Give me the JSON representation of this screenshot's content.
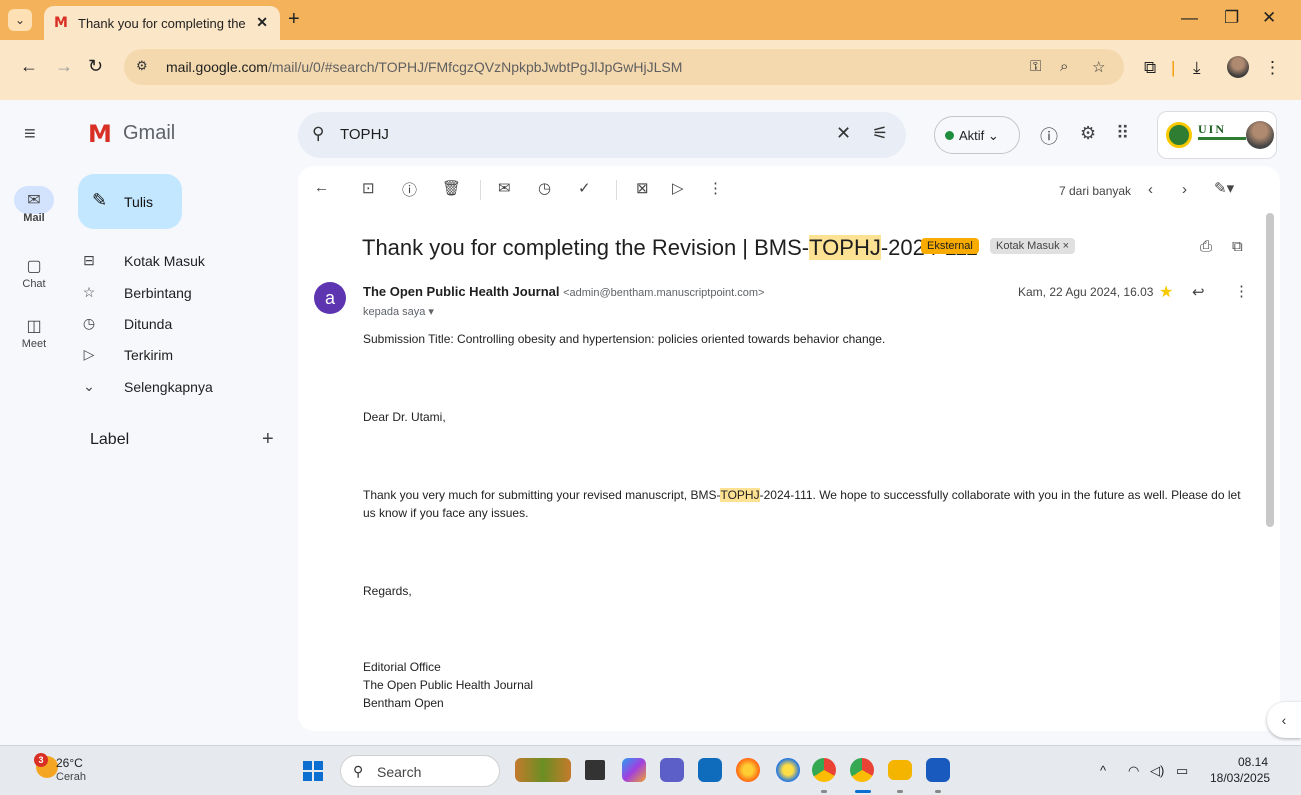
{
  "browser": {
    "tab_title": "Thank you for completing the R",
    "tab_close": "✕",
    "new_tab": "+",
    "url_domain": "mail.google.com",
    "url_path": "/mail/u/0/#search/TOPHJ/FMfcgzQVzNpkpbJwbtPgJlJpGwHjJLSM"
  },
  "gmail": {
    "app_name": "Gmail",
    "compose_label": "Tulis",
    "rail": [
      {
        "label": "Mail",
        "icon": "mail-icon"
      },
      {
        "label": "Chat",
        "icon": "chat-icon"
      },
      {
        "label": "Meet",
        "icon": "meet-icon"
      }
    ],
    "nav": [
      {
        "label": "Kotak Masuk",
        "icon": "inbox-icon"
      },
      {
        "label": "Berbintang",
        "icon": "star-icon"
      },
      {
        "label": "Ditunda",
        "icon": "clock-icon"
      },
      {
        "label": "Terkirim",
        "icon": "send-icon"
      },
      {
        "label": "Selengkapnya",
        "icon": "chevron-down-icon"
      }
    ],
    "label_heading": "Label",
    "search_value": "TOPHJ",
    "status": "Aktif",
    "uin_text": "UIN"
  },
  "message": {
    "pager": "7 dari banyak",
    "subject_prefix": "Thank you for completing the Revision | BMS-",
    "subject_highlight": "TOPHJ",
    "subject_suffix": "-2024-111",
    "badge_external": "Eksternal",
    "badge_inbox": "Kotak Masuk ×",
    "sender_initial": "a",
    "sender_name": "The Open Public Health Journal",
    "sender_email": "<admin@bentham.manuscriptpoint.com>",
    "to": "kepada saya ▾",
    "date": "Kam, 22 Agu 2024, 16.03",
    "body_title": "Submission Title: Controlling obesity and hypertension: policies oriented towards behavior change.",
    "greeting": "Dear Dr. Utami,",
    "body_pre": "Thank you very much for submitting your revised manuscript, BMS-",
    "body_highlight": "TOPHJ",
    "body_post": "-2024-111. We hope to successfully collaborate with you in the future as well. Please do let us know if you face any issues.",
    "regards": "Regards,",
    "sig1": "Editorial Office",
    "sig2": "The Open Public Health Journal",
    "sig3": "Bentham Open"
  },
  "taskbar": {
    "weather_badge": "3",
    "temperature": "26°C",
    "weather": "Cerah",
    "search_label": "Search",
    "time": "08.14",
    "date": "18/03/2025"
  }
}
